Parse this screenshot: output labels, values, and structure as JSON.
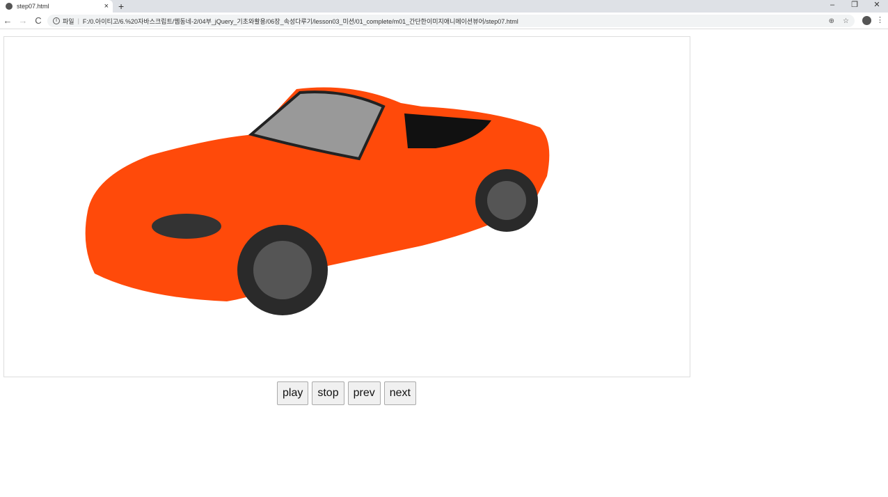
{
  "browser": {
    "tab_title": "step07.html",
    "tab_close": "×",
    "new_tab": "+",
    "window_controls": [
      "–",
      "❐",
      "✕"
    ],
    "nav": {
      "back": "←",
      "forward": "→",
      "reload": "C"
    },
    "address": {
      "info": "i",
      "scheme_label": "파일",
      "url": "F:/0.아이티고/6.%20자바스크립트/웹동네-2/04부_jQuery_기초와활용/06장_속성다루기/lesson03_미션/01_complete/m01_간단한이미지애니메이션뷰어/step07.html"
    },
    "menu": "⋮"
  },
  "viewer": {
    "image_alt": "orange convertible car",
    "colors": {
      "body": "#ff4a0a",
      "tire": "#2a2a2a"
    }
  },
  "controls": {
    "play": "play",
    "stop": "stop",
    "prev": "prev",
    "next": "next"
  }
}
